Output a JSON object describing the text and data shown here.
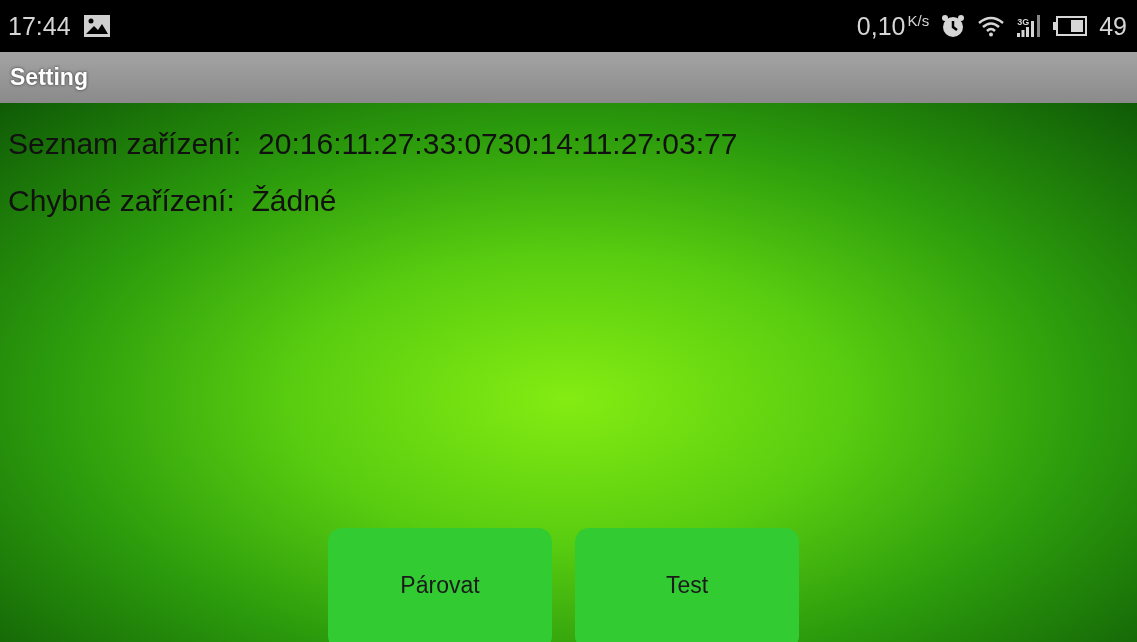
{
  "status_bar": {
    "time": "17:44",
    "speed": "0,10",
    "speed_unit": "K/s",
    "network_type": "3G",
    "battery": "49"
  },
  "title_bar": {
    "title": "Setting"
  },
  "info_lines": [
    {
      "label": "Seznam zařízení:",
      "value": "20:16:11:27:33:0730:14:11:27:03:77"
    },
    {
      "label": "Chybné zařízení:",
      "value": "Žádné"
    }
  ],
  "buttons": [
    "Párovat",
    "Test"
  ]
}
